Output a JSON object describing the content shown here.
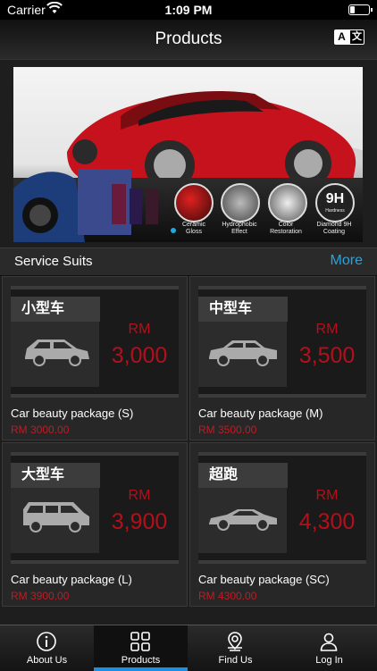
{
  "status": {
    "carrier": "Carrier",
    "time": "1:09 PM"
  },
  "nav": {
    "title": "Products",
    "translate_a": "A",
    "translate_zh": "文"
  },
  "banner": {
    "labels": [
      {
        "id": "ceramic",
        "text": "Ceramic Gloss"
      },
      {
        "id": "hydrophobic",
        "text": "Hydrophobic Effect"
      },
      {
        "id": "color",
        "text": "Color Restoration"
      },
      {
        "id": "diamond",
        "text": "Diamond 9H Coating"
      }
    ],
    "badge_big": "9H",
    "badge_small": "Hardness"
  },
  "section": {
    "title": "Service Suits",
    "more": "More"
  },
  "products": [
    {
      "tag": "小型车",
      "rm": "RM",
      "price": "3,000",
      "name": "Car beauty package (S)",
      "sub": "RM 3000.00",
      "icon": "hatchback-car-icon"
    },
    {
      "tag": "中型车",
      "rm": "RM",
      "price": "3,500",
      "name": "Car beauty package (M)",
      "sub": "RM 3500.00",
      "icon": "sedan-car-icon"
    },
    {
      "tag": "大型车",
      "rm": "RM",
      "price": "3,900",
      "name": "Car beauty package (L)",
      "sub": "RM 3900.00",
      "icon": "van-icon"
    },
    {
      "tag": "超跑",
      "rm": "RM",
      "price": "4,300",
      "name": "Car beauty package (SC)",
      "sub": "RM 4300.00",
      "icon": "sports-car-icon"
    }
  ],
  "tabs": [
    {
      "label": "About Us",
      "icon": "info-icon",
      "active": false
    },
    {
      "label": "Products",
      "icon": "grid-icon",
      "active": true
    },
    {
      "label": "Find Us",
      "icon": "location-pin-icon",
      "active": false
    },
    {
      "label": "Log In",
      "icon": "user-icon",
      "active": false
    }
  ],
  "colors": {
    "accent_blue": "#27a3dd",
    "price_red": "#b3101b",
    "tab_indicator": "#1b8fe3"
  }
}
